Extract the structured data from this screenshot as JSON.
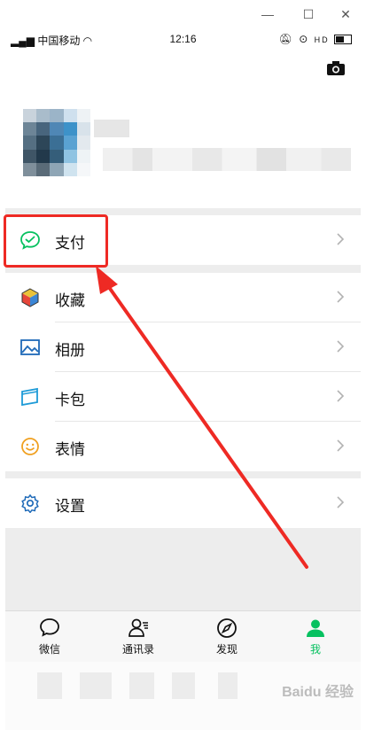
{
  "window": {
    "minimize_glyph": "—",
    "maximize_glyph": "☐",
    "close_glyph": "✕"
  },
  "status_bar": {
    "carrier": "中国移动",
    "time": "12:16",
    "hd_label": "HD"
  },
  "menu": {
    "pay": "支付",
    "favorites": "收藏",
    "album": "相册",
    "cards": "卡包",
    "stickers": "表情",
    "settings": "设置"
  },
  "tabs": {
    "chats": "微信",
    "contacts": "通讯录",
    "discover": "发现",
    "me": "我"
  },
  "colors": {
    "accent": "#07c160",
    "highlight": "#ee2a24",
    "icon_blue": "#1f6ab8"
  },
  "watermark": "Baidu 经验"
}
